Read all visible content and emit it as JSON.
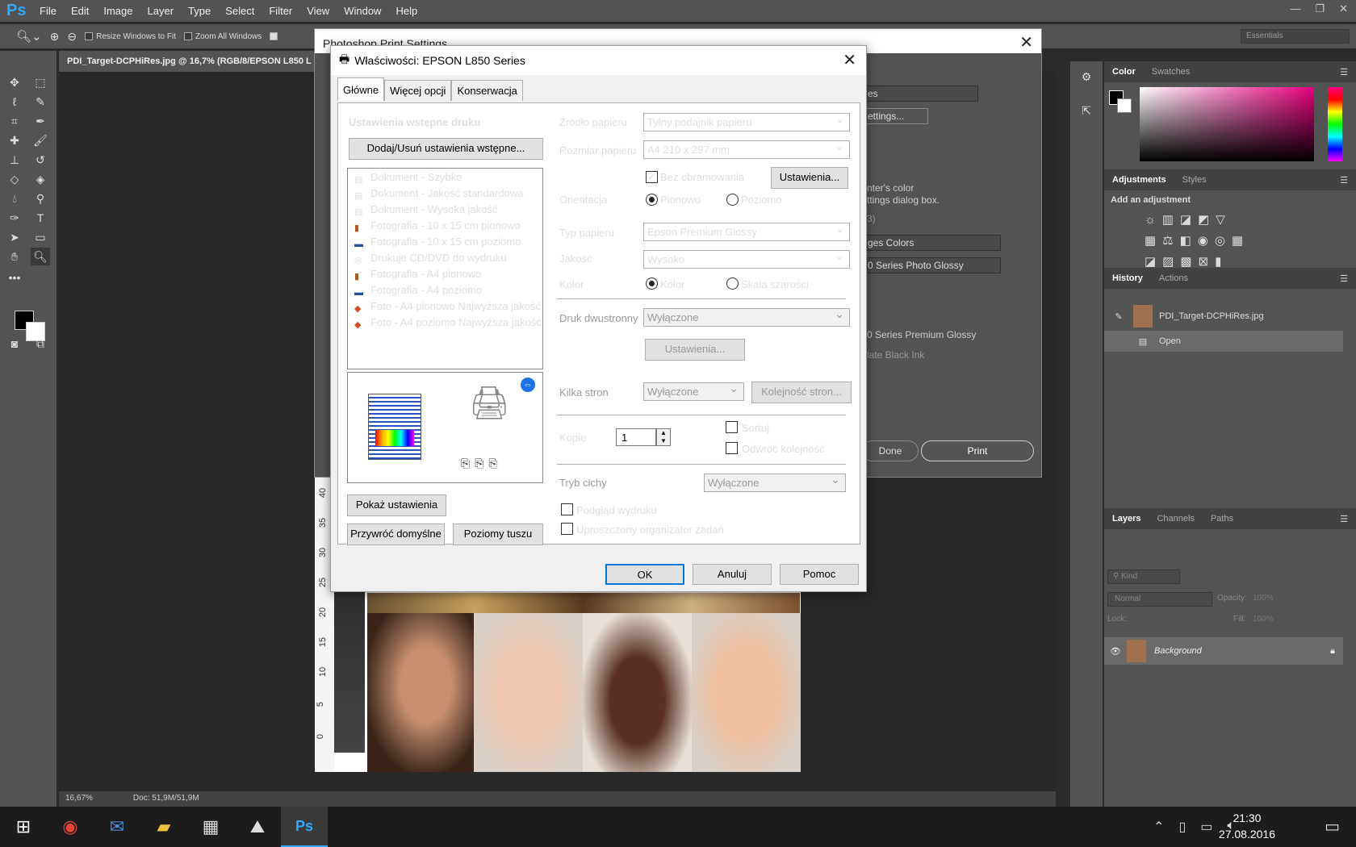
{
  "ps": {
    "logo": "Ps",
    "menu": [
      "File",
      "Edit",
      "Image",
      "Layer",
      "Type",
      "Select",
      "Filter",
      "View",
      "Window",
      "Help"
    ],
    "options": {
      "resize": "Resize Windows to Fit",
      "zoom_all": "Zoom All Windows"
    },
    "workspace": "Essentials",
    "doc_tab": "PDI_Target-DCPHiRes.jpg @ 16,7% (RGB/8/EPSON L850 L",
    "status": {
      "zoom": "16,67%",
      "doc": "Doc: 51,9M/51,9M"
    },
    "ruler_ticks": [
      "40",
      "35",
      "30",
      "25",
      "20",
      "15",
      "10",
      "5",
      "0"
    ]
  },
  "panels": {
    "color_tabs": [
      "Color",
      "Swatches"
    ],
    "adj_tabs": [
      "Adjustments",
      "Styles"
    ],
    "adj_title": "Add an adjustment",
    "history_tabs": [
      "History",
      "Actions"
    ],
    "history_items": [
      "PDI_Target-DCPHiRes.jpg",
      "Open"
    ],
    "layers_tabs": [
      "Layers",
      "Channels",
      "Paths"
    ],
    "kind": "Kind",
    "blend": "Normal",
    "opacity_label": "Opacity:",
    "opacity_value": "100%",
    "lock_label": "Lock:",
    "fill_label": "Fill:",
    "fill_value": "100%",
    "layer_name": "Background"
  },
  "print_settings": {
    "title": "Photoshop Print Settings",
    "fragments": [
      "es",
      "ettings...",
      "nter's color",
      "ttings dialog box.",
      "3)",
      "ges Colors",
      "0 Series Photo Glossy",
      "0 Series Premium Glossy",
      "late Black Ink"
    ],
    "done": "Done",
    "print": "Print"
  },
  "epson": {
    "title": "Właściwości: EPSON L850 Series",
    "tabs": [
      "Główne",
      "Więcej opcji",
      "Konserwacja"
    ],
    "presets_title": "Ustawienia wstępne druku",
    "add_remove": "Dodaj/Usuń ustawienia wstępne...",
    "presets": [
      {
        "icon": "doc",
        "label": "Dokument - Szybko"
      },
      {
        "icon": "doc",
        "label": "Dokument - Jakość standardowa"
      },
      {
        "icon": "doc",
        "label": "Dokument - Wysoka jakość"
      },
      {
        "icon": "photo-portrait",
        "label": "Fotografia - 10 x 15 cm pionowo"
      },
      {
        "icon": "photo-landscape",
        "label": "Fotografia - 10 x 15 cm poziomo"
      },
      {
        "icon": "cd",
        "label": "Drukuje CD/DVD do wydruku"
      },
      {
        "icon": "photo-portrait",
        "label": "Fotografia - A4 pionowo"
      },
      {
        "icon": "photo-landscape",
        "label": "Fotografia - A4 poziomo"
      },
      {
        "icon": "photo-best",
        "label": "Foto - A4 pionowo Najwyższa jakość"
      },
      {
        "icon": "photo-best",
        "label": "Foto - A4 poziomo Najwyższa jakość"
      }
    ],
    "show_settings": "Pokaż ustawienia",
    "restore_defaults": "Przywróć domyślne",
    "ink_levels": "Poziomy tuszu",
    "paper_source_label": "Źródło papieru",
    "paper_source": "Tylny podajnik papieru",
    "paper_size_label": "Rozmiar papieru",
    "paper_size": "A4 210 x 297 mm",
    "borderless": "Bez obramowania",
    "settings_btn": "Ustawienia...",
    "orientation_label": "Orientacja",
    "portrait": "Pionowo",
    "landscape": "Poziomo",
    "paper_type_label": "Typ papieru",
    "paper_type": "Epson Premium Glossy",
    "quality_label": "Jakość",
    "quality": "Wysoko",
    "color_label": "Kolor",
    "color": "Kolor",
    "grayscale": "Skala szarości",
    "duplex_label": "Druk dwustronny",
    "duplex": "Wyłączone",
    "duplex_settings": "Ustawienia...",
    "multipage_label": "Kilka stron",
    "multipage": "Wyłączone",
    "page_order": "Kolejność stron...",
    "copies_label": "Kopie",
    "copies": "1",
    "collate": "Sortuj",
    "reverse": "Odwróć kolejność",
    "quiet_label": "Tryb cichy",
    "quiet": "Wyłączone",
    "preview": "Podgląd wydruku",
    "job_arranger": "Uproszczony organizator zadań",
    "ok": "OK",
    "cancel": "Anuluj",
    "help": "Pomoc"
  },
  "taskbar": {
    "time": "21:30",
    "date": "27.08.2016"
  }
}
